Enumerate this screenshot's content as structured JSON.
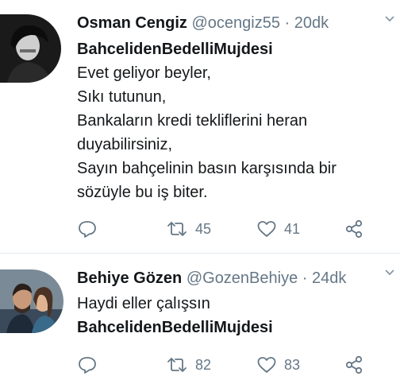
{
  "tweets": [
    {
      "name": "Osman Cengiz",
      "handle": "@ocengiz55",
      "separator": "·",
      "time": "20dk",
      "hashtag": "BahcelidenBedelliMujdesi",
      "lines": [
        "Evet geliyor beyler,",
        "Sıkı tutunun,",
        "Bankaların kredi tekliflerini heran",
        "duyabilirsiniz,",
        "Sayın bahçelinin basın karşısında bir",
        "sözüyle bu iş biter."
      ],
      "retweets": "45",
      "likes": "41"
    },
    {
      "name": "Behiye Gözen",
      "handle": "@GozenBehiye",
      "separator": "·",
      "time": "24dk",
      "lines": [
        "Haydi eller çalışsın"
      ],
      "hashtag": "BahcelidenBedelliMujdesi",
      "retweets": "82",
      "likes": "83"
    }
  ],
  "icons": {
    "reply": "reply-icon",
    "retweet": "retweet-icon",
    "like": "heart-icon",
    "share": "share-icon",
    "menu": "chevron-down-icon"
  },
  "colors": {
    "text": "#14171a",
    "muted": "#657786",
    "divider": "#e1e8ed"
  }
}
